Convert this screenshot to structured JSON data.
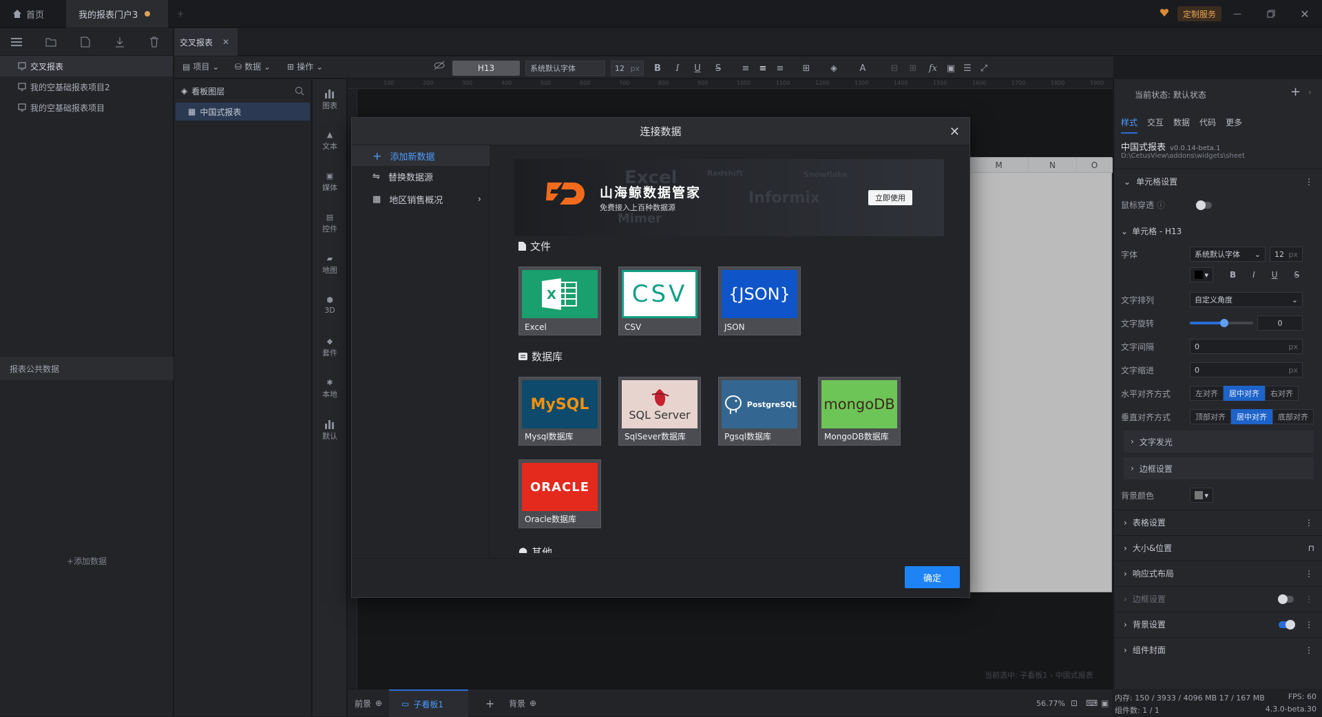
{
  "titlebar": {
    "tabs": [
      {
        "label": "首页"
      },
      {
        "label": "我的报表门户3"
      }
    ],
    "service_label": "定制服务"
  },
  "left_panel": {
    "projects": [
      {
        "label": "交叉报表",
        "selected": true
      },
      {
        "label": "我的空基础报表项目2"
      },
      {
        "label": "我的空基础报表项目"
      }
    ],
    "public_data_title": "报表公共数据",
    "add_data_label": "+添加数据"
  },
  "doc_tab": {
    "label": "交叉报表"
  },
  "toolbar": {
    "menus": [
      {
        "label": "项目"
      },
      {
        "label": "数据"
      },
      {
        "label": "操作"
      }
    ],
    "cell_ref": "H13",
    "font": "系统默认字体",
    "font_size": "12",
    "font_unit": "px"
  },
  "layers": {
    "title": "看板图层",
    "item": "中国式报表"
  },
  "widget_rail": [
    {
      "label": "图表",
      "icon": "bar-chart-icon"
    },
    {
      "label": "文本",
      "icon": "text-icon"
    },
    {
      "label": "媒体",
      "icon": "media-icon"
    },
    {
      "label": "控件",
      "icon": "control-icon"
    },
    {
      "label": "地图",
      "icon": "map-icon"
    },
    {
      "label": "3D",
      "icon": "cube-icon"
    },
    {
      "label": "套件",
      "icon": "kit-icon"
    },
    {
      "label": "本地",
      "icon": "local-icon"
    },
    {
      "label": "默认",
      "icon": "default-icon"
    }
  ],
  "ruler_ticks": [
    "100",
    "200",
    "300",
    "400",
    "500",
    "600",
    "700",
    "800",
    "900",
    "1000",
    "1100",
    "1200",
    "1300",
    "1400",
    "1500",
    "1600",
    "1700",
    "1800",
    "1900"
  ],
  "sheet": {
    "columns": [
      "M",
      "N",
      "O"
    ]
  },
  "canvas": {
    "breadcrumb": "当前选中: 子看板1 › 中国式报表"
  },
  "bottom_bar": {
    "front_label": "前景",
    "sub_board_label": "子看板1",
    "back_label": "背景",
    "zoom": "56.77%"
  },
  "modal": {
    "title": "连接数据",
    "nav": [
      {
        "label": "添加新数据",
        "selected": true
      },
      {
        "label": "替换数据源"
      },
      {
        "label": "地区销售概况"
      }
    ],
    "banner": {
      "title": "山海鲸数据管家",
      "subtitle": "免费接入上百种数据源",
      "button": "立即使用",
      "watermarks": [
        "Excel",
        "Informix",
        "Mimer",
        "Redshift",
        "Snowflake"
      ]
    },
    "file_section": "文件",
    "files": [
      {
        "logo": "excel-logo",
        "label": "Excel"
      },
      {
        "logo": "csv-logo",
        "label": "CSV"
      },
      {
        "logo": "json-logo",
        "label": "JSON"
      }
    ],
    "db_section": "数据库",
    "databases": [
      {
        "logo": "mysql-logo",
        "label": "Mysql数据库"
      },
      {
        "logo": "sqlserver-logo",
        "label": "SqlSever数据库"
      },
      {
        "logo": "postgresql-logo",
        "label": "Pgsql数据库"
      },
      {
        "logo": "mongodb-logo",
        "label": "MongoDB数据库"
      },
      {
        "logo": "oracle-logo",
        "label": "Oracle数据库"
      }
    ],
    "logo_text": {
      "excel": "X",
      "csv": "CSV",
      "json": "{JSON}",
      "mysql": "MySQL",
      "sql": "SQL Server",
      "pg": "PostgreSQL",
      "mongo": "mongoDB",
      "oracle": "ORACLE"
    },
    "other_section": "其他",
    "ok_label": "确定"
  },
  "right_panel": {
    "state_label": "当前状态: 默认状态",
    "tabs": [
      "样式",
      "交互",
      "数据",
      "代码",
      "更多"
    ],
    "component_name": "中国式报表",
    "version": "v0.0.14-beta.1",
    "path": "D:\\CetusView\\addons\\widgets\\sheet",
    "cell_settings": "单元格设置",
    "mouse_through": "鼠标穿透",
    "cell_title": "单元格 - H13",
    "font_label": "字体",
    "font_value": "系统默认字体",
    "font_size": "12",
    "font_unit": "px",
    "text_arrange_label": "文字排列",
    "text_arrange_value": "自定义角度",
    "rotate_label": "文字旋转",
    "rotate_value": "0",
    "spacing_label": "文字间隔",
    "spacing_value": "0",
    "indent_label": "文字缩进",
    "indent_value": "0",
    "halign_label": "水平对齐方式",
    "halign": [
      "左对齐",
      "居中对齐",
      "右对齐"
    ],
    "valign_label": "垂直对齐方式",
    "valign": [
      "顶部对齐",
      "居中对齐",
      "底部对齐"
    ],
    "glow_label": "文字发光",
    "border_label": "边框设置",
    "bg_label": "背景颜色",
    "sections": [
      "表格设置",
      "大小&位置",
      "响应式布局",
      "边框设置",
      "背景设置",
      "组件封面"
    ]
  },
  "status": {
    "memory": "内存: 150 / 3933 / 4096 MB 17 / 167 MB",
    "fps": "FPS: 60",
    "components": "组件数: 1 / 1",
    "version": "4.3.0-beta.30"
  },
  "colors": {
    "accent": "#1e84f5",
    "selected_nav": "#4d9cff",
    "service": "#e8a352"
  }
}
